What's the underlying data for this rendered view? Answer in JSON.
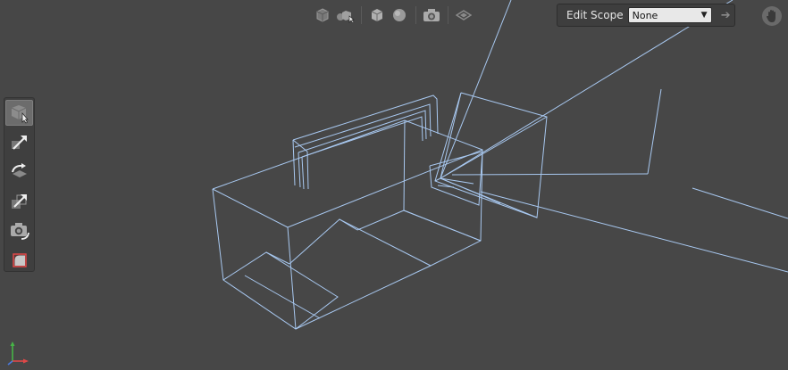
{
  "top_toolbar": {
    "buttons": [
      {
        "name": "object-mode-icon"
      },
      {
        "name": "multi-object-mode-icon"
      },
      {
        "name": "box-shade-icon"
      },
      {
        "name": "sphere-shade-icon"
      },
      {
        "name": "camera-icon"
      },
      {
        "name": "stage-toggle-icon"
      }
    ]
  },
  "edit_scope": {
    "label": "Edit Scope",
    "value": "None"
  },
  "tool_palette": {
    "items": [
      {
        "name": "select-tool-icon",
        "active": true
      },
      {
        "name": "translate-tool-icon",
        "active": false
      },
      {
        "name": "rotate-tool-icon",
        "active": false
      },
      {
        "name": "scale-tool-icon",
        "active": false
      },
      {
        "name": "camera-tool-icon",
        "active": false
      },
      {
        "name": "crop-tool-icon",
        "active": false
      }
    ]
  },
  "colors": {
    "background": "#474747",
    "wireframe": "#a8c8f0",
    "axis_x": "#e04848",
    "axis_y": "#46b446",
    "axis_z": "#4a7ae0"
  }
}
